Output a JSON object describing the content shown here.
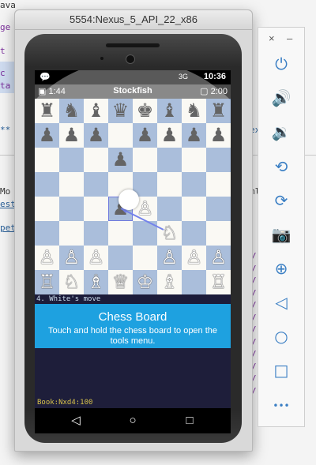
{
  "ide": {
    "fragments": [
      "ava",
      "ge",
      "t",
      "c",
      "ta",
      "**",
      "Mo",
      "est",
      "pet",
      "ex",
      "ml"
    ],
    "right_lines": [
      "/",
      "/",
      "/",
      "/",
      "/",
      "/",
      "/",
      "/",
      "/",
      "/",
      "/",
      "/"
    ]
  },
  "emulator": {
    "title": "5554:Nexus_5_API_22_x86"
  },
  "statusbar": {
    "time": "10:36",
    "signal": "3G"
  },
  "clocks": {
    "left_time": "1:44",
    "engine": "Stockfish",
    "right_time": "2:00"
  },
  "board": {
    "pieces": [
      {
        "sq": "a8",
        "p": "♜",
        "c": "b"
      },
      {
        "sq": "b8",
        "p": "♞",
        "c": "b"
      },
      {
        "sq": "c8",
        "p": "♝",
        "c": "b"
      },
      {
        "sq": "d8",
        "p": "♛",
        "c": "b"
      },
      {
        "sq": "e8",
        "p": "♚",
        "c": "b"
      },
      {
        "sq": "f8",
        "p": "♝",
        "c": "b"
      },
      {
        "sq": "g8",
        "p": "♞",
        "c": "b"
      },
      {
        "sq": "h8",
        "p": "♜",
        "c": "b"
      },
      {
        "sq": "a7",
        "p": "♟",
        "c": "b"
      },
      {
        "sq": "b7",
        "p": "♟",
        "c": "b"
      },
      {
        "sq": "c7",
        "p": "♟",
        "c": "b"
      },
      {
        "sq": "e7",
        "p": "♟",
        "c": "b"
      },
      {
        "sq": "f7",
        "p": "♟",
        "c": "b"
      },
      {
        "sq": "g7",
        "p": "♟",
        "c": "b"
      },
      {
        "sq": "h7",
        "p": "♟",
        "c": "b"
      },
      {
        "sq": "d6",
        "p": "♟",
        "c": "b"
      },
      {
        "sq": "d4",
        "p": "♟",
        "c": "b"
      },
      {
        "sq": "e4",
        "p": "♙",
        "c": "w"
      },
      {
        "sq": "f3",
        "p": "♘",
        "c": "w"
      },
      {
        "sq": "a2",
        "p": "♙",
        "c": "w"
      },
      {
        "sq": "b2",
        "p": "♙",
        "c": "w"
      },
      {
        "sq": "c2",
        "p": "♙",
        "c": "w"
      },
      {
        "sq": "f2",
        "p": "♙",
        "c": "w"
      },
      {
        "sq": "g2",
        "p": "♙",
        "c": "w"
      },
      {
        "sq": "h2",
        "p": "♙",
        "c": "w"
      },
      {
        "sq": "a1",
        "p": "♖",
        "c": "w"
      },
      {
        "sq": "b1",
        "p": "♘",
        "c": "w"
      },
      {
        "sq": "c1",
        "p": "♗",
        "c": "w"
      },
      {
        "sq": "d1",
        "p": "♕",
        "c": "w"
      },
      {
        "sq": "e1",
        "p": "♔",
        "c": "w"
      },
      {
        "sq": "f1",
        "p": "♗",
        "c": "w"
      },
      {
        "sq": "h1",
        "p": "♖",
        "c": "w"
      }
    ],
    "light_color": "#f7f6ef",
    "dark_color": "#7d9cc8",
    "arrow_color": "#2a3fe0"
  },
  "move_status": "4. White's move",
  "tooltip": {
    "title": "Chess Board",
    "body": "Touch and hold the chess board to open the tools menu."
  },
  "book": "Book:Nxd4:100",
  "navbar": {
    "back_icon": "◁",
    "home_icon": "○",
    "recents_icon": "□"
  },
  "toolbar": {
    "close_icon": "×",
    "minimize_icon": "–",
    "buttons": [
      {
        "name": "power",
        "glyph": "⏻"
      },
      {
        "name": "volume-up",
        "glyph": "🔊"
      },
      {
        "name": "volume-down",
        "glyph": "🔉"
      },
      {
        "name": "rotate-left",
        "glyph": "⟲"
      },
      {
        "name": "rotate-right",
        "glyph": "⟳"
      },
      {
        "name": "camera",
        "glyph": "📷"
      },
      {
        "name": "zoom",
        "glyph": "⊕"
      },
      {
        "name": "back",
        "glyph": "◁"
      },
      {
        "name": "home",
        "glyph": "○"
      },
      {
        "name": "overview",
        "glyph": "□"
      },
      {
        "name": "more",
        "glyph": "•••"
      }
    ]
  }
}
